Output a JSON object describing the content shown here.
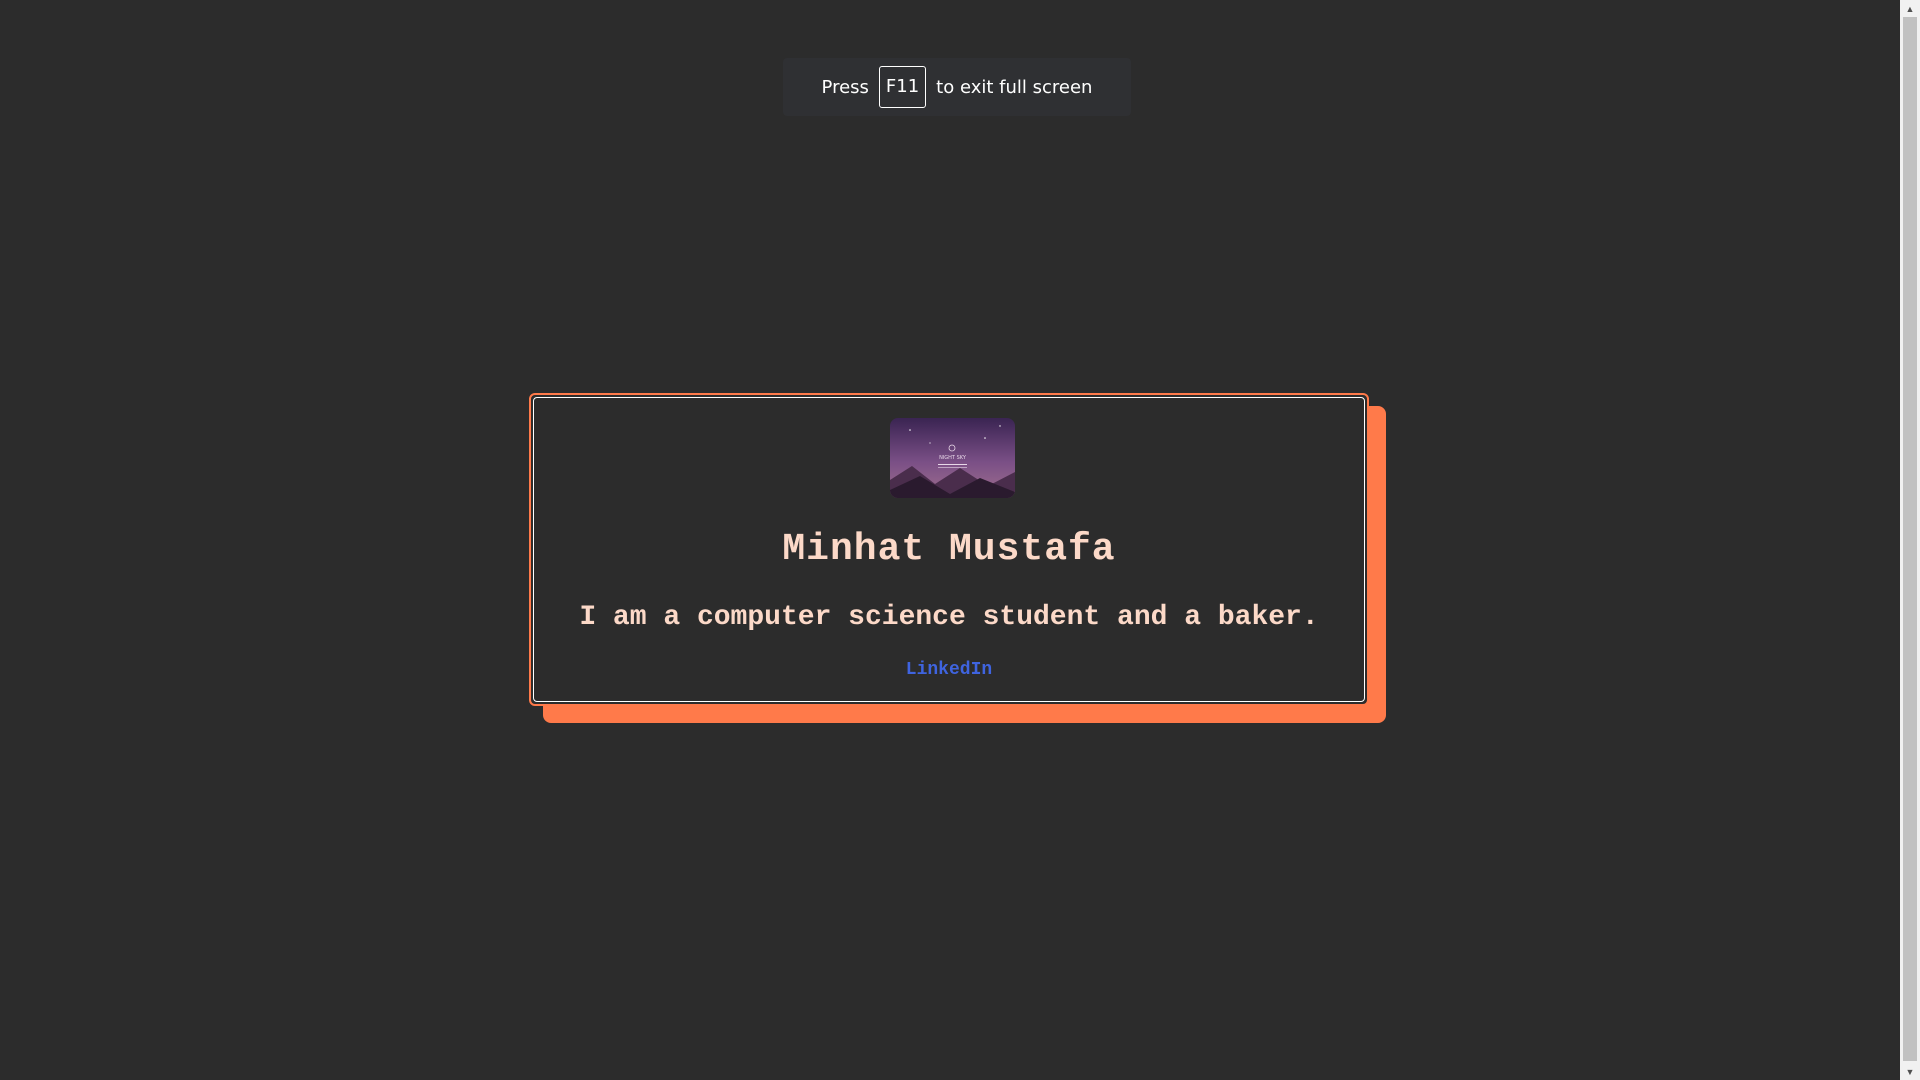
{
  "fullscreen_notice": {
    "press": "Press",
    "key": "F11",
    "message": "to exit full screen"
  },
  "profile": {
    "image_alt": "Night sky mountain illustration",
    "image_caption": "NIGHT SKY",
    "name": "Minhat Mustafa",
    "bio": "I am a computer science student and a baker.",
    "link_label": "LinkedIn"
  },
  "colors": {
    "background": "#2c2c2c",
    "accent": "#ff7a4a",
    "text": "#fcd9c8",
    "link": "#3f64e0"
  },
  "icons": {
    "scroll_up": "triangle-up-icon",
    "scroll_down": "triangle-down-icon"
  }
}
